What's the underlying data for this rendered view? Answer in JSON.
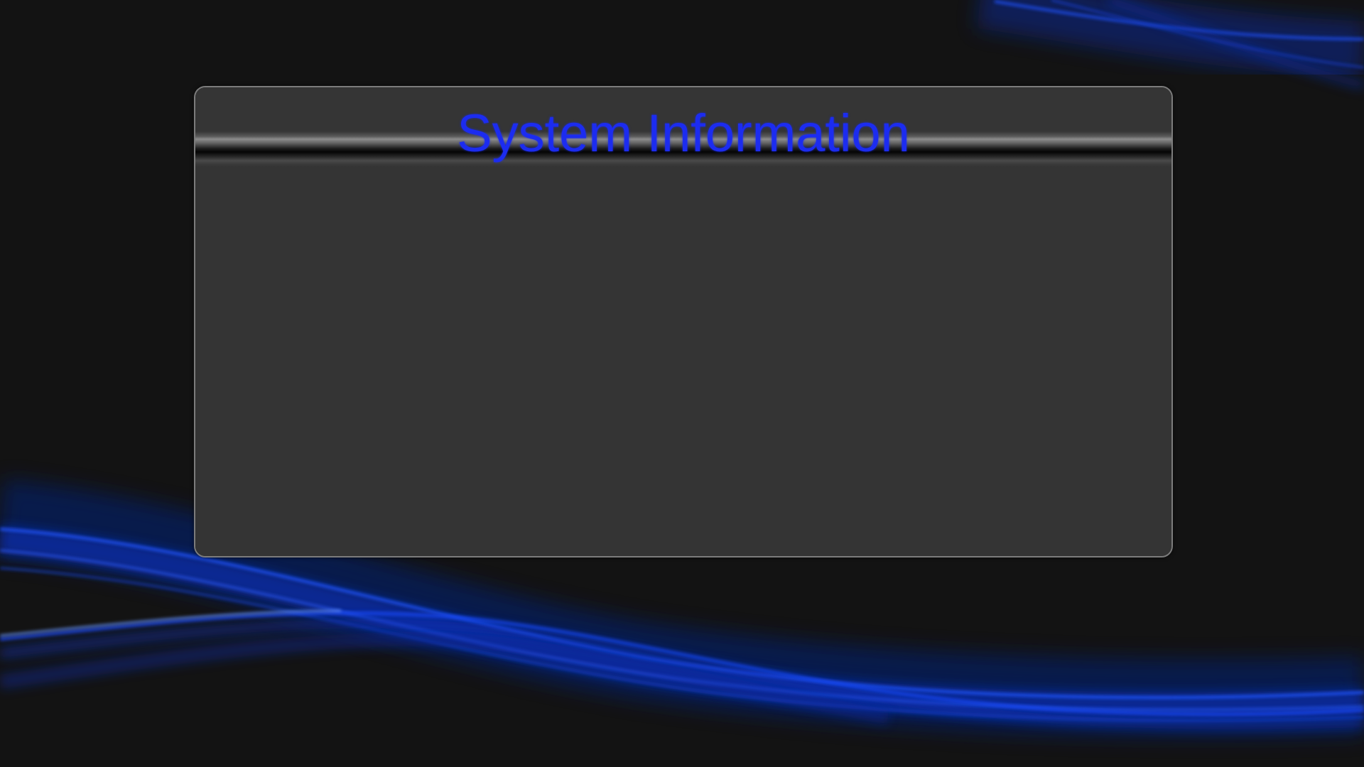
{
  "dialog": {
    "title": "System Information"
  },
  "colors": {
    "background": "#131313",
    "panel": "#343434",
    "panel_border": "#7c7c7c",
    "title_text": "#1c2cf0",
    "wave_accent": "#0a3cff"
  },
  "background": {
    "decoration": "blue-light-waves"
  }
}
